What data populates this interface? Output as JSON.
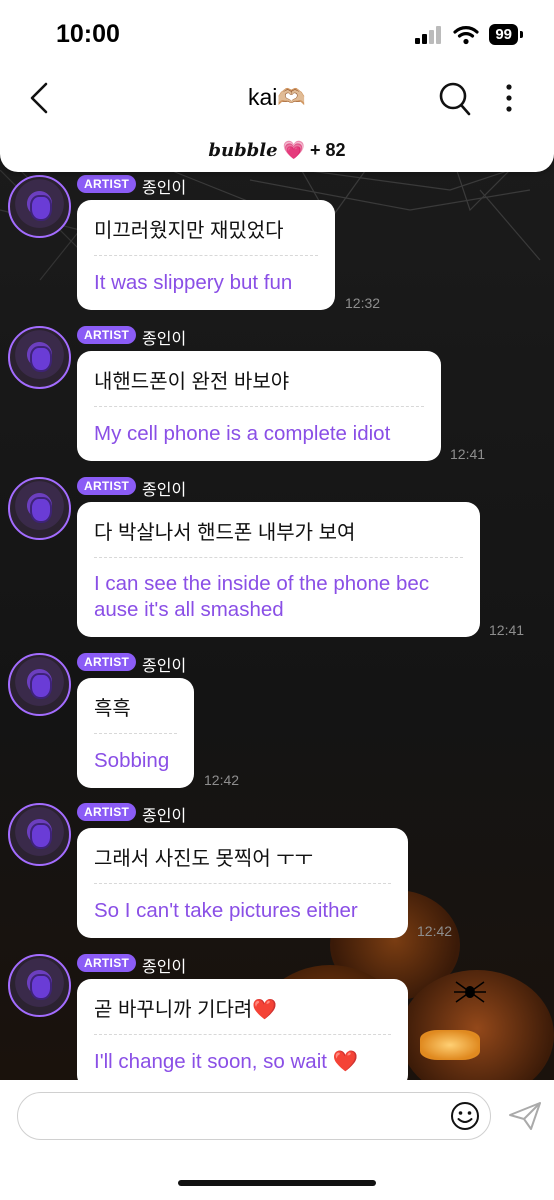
{
  "status": {
    "time": "10:00",
    "battery": "99"
  },
  "header": {
    "title": "kai🫶🏼",
    "bubble_brand": "bubble",
    "bubble_heart": "💗",
    "bubble_count": "+ 82"
  },
  "messages": [
    {
      "badge": "ARTIST",
      "name": "종인이",
      "ko": "미끄러웠지만 재밌었다",
      "en": "It was slippery but fun",
      "time": "12:32"
    },
    {
      "badge": "ARTIST",
      "name": "종인이",
      "ko": "내핸드폰이 완전 바보야",
      "en": "My cell phone is a complete idiot",
      "time": "12:41"
    },
    {
      "badge": "ARTIST",
      "name": "종인이",
      "ko": "다 박살나서 핸드폰 내부가 보여",
      "en": "I can see the inside of the phone bec\nause it's all smashed",
      "time": "12:41"
    },
    {
      "badge": "ARTIST",
      "name": "종인이",
      "ko": "흑흑",
      "en": "Sobbing",
      "time": "12:42"
    },
    {
      "badge": "ARTIST",
      "name": "종인이",
      "ko": "그래서 사진도 못찍어 ㅜㅜ",
      "en": "So I can't take pictures either",
      "time": "12:42"
    },
    {
      "badge": "ARTIST",
      "name": "종인이",
      "ko": "곧 바꾸니까 기다려❤️",
      "en": "I'll change it soon, so wait ❤️",
      "time": ""
    }
  ],
  "input": {
    "placeholder": ""
  },
  "icons": {
    "back": "chevron-left-icon",
    "search": "search-icon",
    "more": "more-vertical-icon",
    "emoji": "smile-icon",
    "send": "send-icon"
  },
  "colors": {
    "accent": "#8b5cf6",
    "translation": "#8a4fe6",
    "header_bg": "#ffffff",
    "chat_bg": "#1b1b1b"
  }
}
